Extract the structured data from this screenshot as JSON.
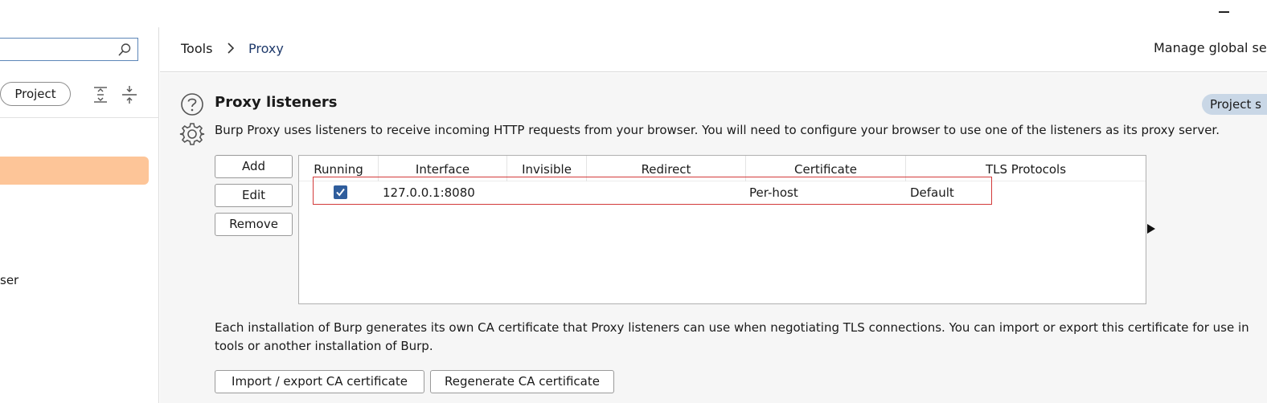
{
  "sidebar": {
    "search_placeholder": "",
    "scope_label": "Project",
    "partial_item_text": "ser"
  },
  "breadcrumb": {
    "tools": "Tools",
    "proxy": "Proxy"
  },
  "header": {
    "manage_global": "Manage global se"
  },
  "section": {
    "title": "Proxy listeners",
    "badge": "Project s",
    "description": "Burp Proxy uses listeners to receive incoming HTTP requests from your browser. You will need to configure your browser to use one of the listeners as its proxy server."
  },
  "buttons": {
    "add": "Add",
    "edit": "Edit",
    "remove": "Remove",
    "import_export": "Import / export CA certificate",
    "regenerate": "Regenerate CA certificate"
  },
  "table": {
    "columns": [
      "Running",
      "Interface",
      "Invisible",
      "Redirect",
      "Certificate",
      "TLS Protocols"
    ],
    "rows": [
      {
        "running": true,
        "interface": "127.0.0.1:8080",
        "invisible": "",
        "redirect": "",
        "certificate": "Per-host",
        "tls_protocols": "Default"
      }
    ]
  },
  "ca_description": "Each installation of Burp generates its own CA certificate that Proxy listeners can use when negotiating TLS connections. You can import or export this certificate for use in tools or another installation of Burp.",
  "colors": {
    "selected_item": "#fdc598",
    "highlight_border": "#d33a3a",
    "checkbox": "#2f5d9c",
    "badge": "#c9d7e6",
    "breadcrumb_active": "#1f3a6b"
  },
  "icons": [
    "search-icon",
    "expand-all-icon",
    "collapse-all-icon",
    "chevron-right-icon",
    "help-icon",
    "gear-icon",
    "checkmark-icon",
    "triangle-right-icon",
    "minimize-icon"
  ]
}
